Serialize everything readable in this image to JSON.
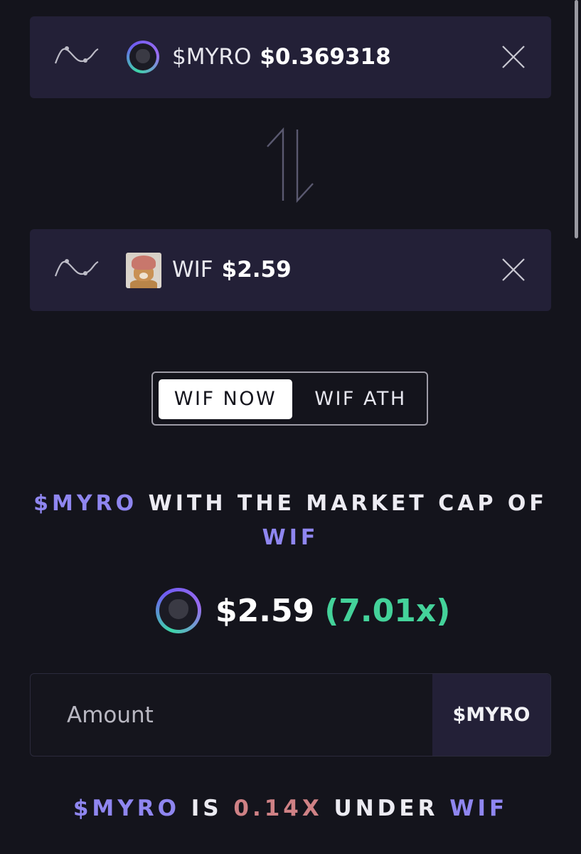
{
  "from_token": {
    "symbol": "$MYRO",
    "price": "$0.369318"
  },
  "to_token": {
    "symbol": "WIF",
    "price": "$2.59"
  },
  "toggle": {
    "options": [
      "WIF NOW",
      "WIF ATH"
    ],
    "selected": "WIF NOW"
  },
  "headline": {
    "subject": "$MYRO",
    "middle": " WITH THE MARKET CAP OF",
    "target": "WIF"
  },
  "result": {
    "price": "$2.59",
    "multiplier": "(7.01x)",
    "multiplier_color": "#44d29a"
  },
  "amount": {
    "placeholder": "Amount",
    "value": "",
    "unit": "$MYRO"
  },
  "summary": {
    "subject": "$MYRO",
    "is": " IS ",
    "mult": "0.14X",
    "under": " UNDER ",
    "target": "WIF"
  },
  "colors": {
    "accent": "#8f86f0",
    "card": "#232037",
    "background": "#14141c",
    "under_mult": "#cf8185"
  },
  "icons": [
    "chart-line-icon",
    "token-avatar",
    "close-icon",
    "swap-arrows-icon"
  ]
}
